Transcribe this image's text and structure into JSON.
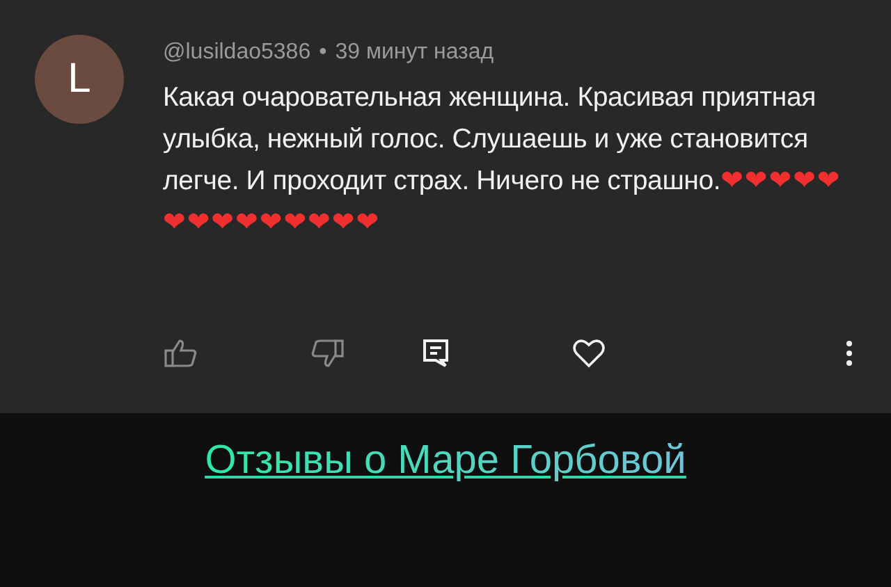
{
  "comment": {
    "avatar_letter": "L",
    "author": "@lusildao5386",
    "separator": "•",
    "time": "39 минут назад",
    "text": "Какая очаровательная женщина. Красивая приятная улыбка, нежный голос. Слушаешь и уже становится легче. И проходит страх. Ничего не страшно.",
    "hearts": "❤❤❤❤❤❤❤❤❤❤❤❤❤❤"
  },
  "link": {
    "label": "Отзывы о Маре Горбовой"
  }
}
